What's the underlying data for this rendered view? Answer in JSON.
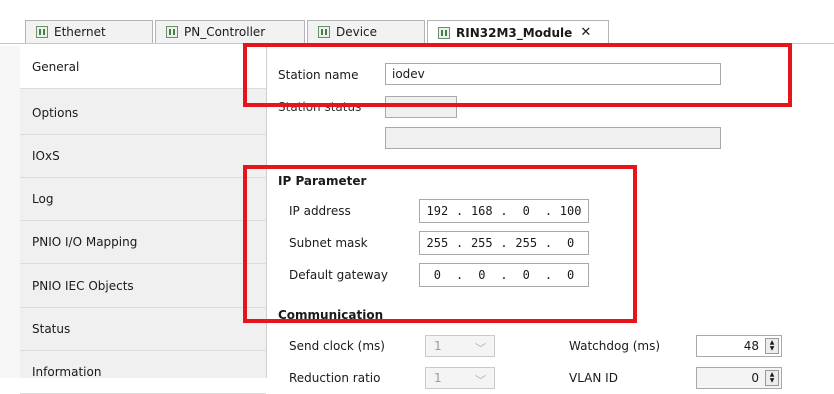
{
  "tabs": [
    {
      "label": "Ethernet",
      "active": false
    },
    {
      "label": "PN_Controller",
      "active": false
    },
    {
      "label": "Device",
      "active": false
    },
    {
      "label": "RIN32M3_Module",
      "active": true,
      "close": "✕"
    }
  ],
  "nav": {
    "items": [
      "General",
      "Options",
      "IOxS",
      "Log",
      "PNIO I/O Mapping",
      "PNIO IEC Objects",
      "Status",
      "Information"
    ]
  },
  "general": {
    "station_name_label": "Station name",
    "station_name_value": "iodev",
    "station_status_label": "Station status",
    "station_status_value": "",
    "status_text_value": ""
  },
  "ip": {
    "title": "IP Parameter",
    "address_label": "IP address",
    "address": [
      "192",
      "168",
      "0",
      "100"
    ],
    "subnet_label": "Subnet mask",
    "subnet": [
      "255",
      "255",
      "255",
      "0"
    ],
    "gateway_label": "Default gateway",
    "gateway": [
      "0",
      "0",
      "0",
      "0"
    ]
  },
  "communication": {
    "title": "Communication",
    "send_clock_label": "Send clock (ms)",
    "send_clock_value": "1",
    "watchdog_label": "Watchdog (ms)",
    "watchdog_value": "48",
    "reduction_label": "Reduction ratio",
    "reduction_value": "1",
    "vlan_label": "VLAN ID",
    "vlan_value": "0"
  },
  "colors": {
    "highlight": "#e8141b",
    "nav_bg": "#f0f0f0"
  }
}
